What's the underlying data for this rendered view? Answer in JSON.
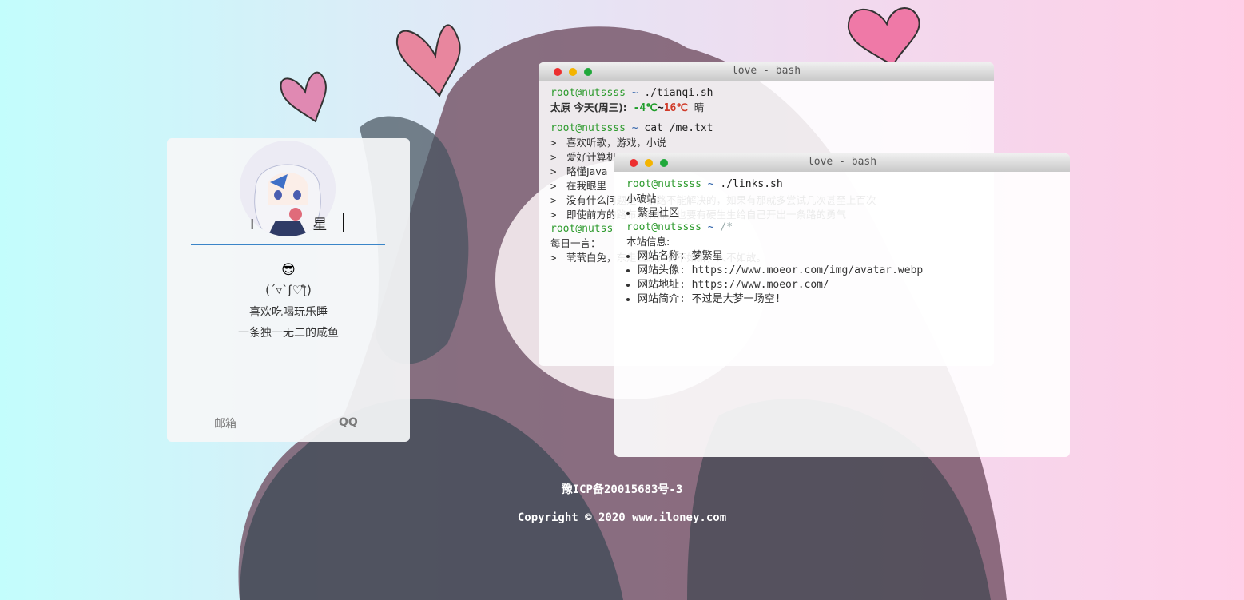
{
  "profile": {
    "name_partial": "I",
    "name_partial_end": "星",
    "emoji": "😎",
    "kaomoji": "(´▿`ʃ♡ƪ)",
    "line1": "喜欢吃喝玩乐睡",
    "line2": "一条独一无二的咸鱼",
    "links": {
      "mail": "邮箱",
      "qq": "QQ"
    }
  },
  "terminal1": {
    "title": "love - bash",
    "prompt_user": "root@nutssss",
    "prompt_tilde": "~",
    "cmd1": "./tianqi.sh",
    "weather": {
      "city": "太原 今天(周三):",
      "low": "-4℃",
      "sep": "~",
      "high": "16℃",
      "cond": "晴"
    },
    "cmd2": "cat /me.txt",
    "me_lines": [
      "喜欢听歌，游戏，小说",
      "爱好计算机",
      "略懂Java",
      "在我眼里",
      "没有什么问题是一条路不能解决的，如果有那就多尝试几次甚至上百次",
      "即使前方的路布满荆棘，也要有硬生生给自己开出一条路的勇气"
    ],
    "prompt3": "root@nutss",
    "daily_label": "每日一言：",
    "daily_quote": "茕茕白兔，东走西顾，衣不如新，人不如故。"
  },
  "terminal2": {
    "title": "love - bash",
    "prompt_user": "root@nutssss",
    "prompt_tilde": "~",
    "cmd1": "./links.sh",
    "site_label": "小破站:",
    "site_items": [
      "繁星社区"
    ],
    "comment": "/*",
    "info_label": "本站信息:",
    "info_items": [
      "网站名称: 梦繁星",
      "网站头像: https://www.moeor.com/img/avatar.webp",
      "网站地址: https://www.moeor.com/",
      "网站简介: 不过是大梦一场空!"
    ]
  },
  "footer": {
    "icp": "豫ICP备20015683号-3",
    "copyright": "Copyright © 2020 www.iloney.com"
  },
  "colors": {
    "accent_line": "#3a85c8",
    "prompt_user": "#2c9a2c",
    "temp_low": "#1f9d2a",
    "temp_high": "#d03b2a"
  }
}
